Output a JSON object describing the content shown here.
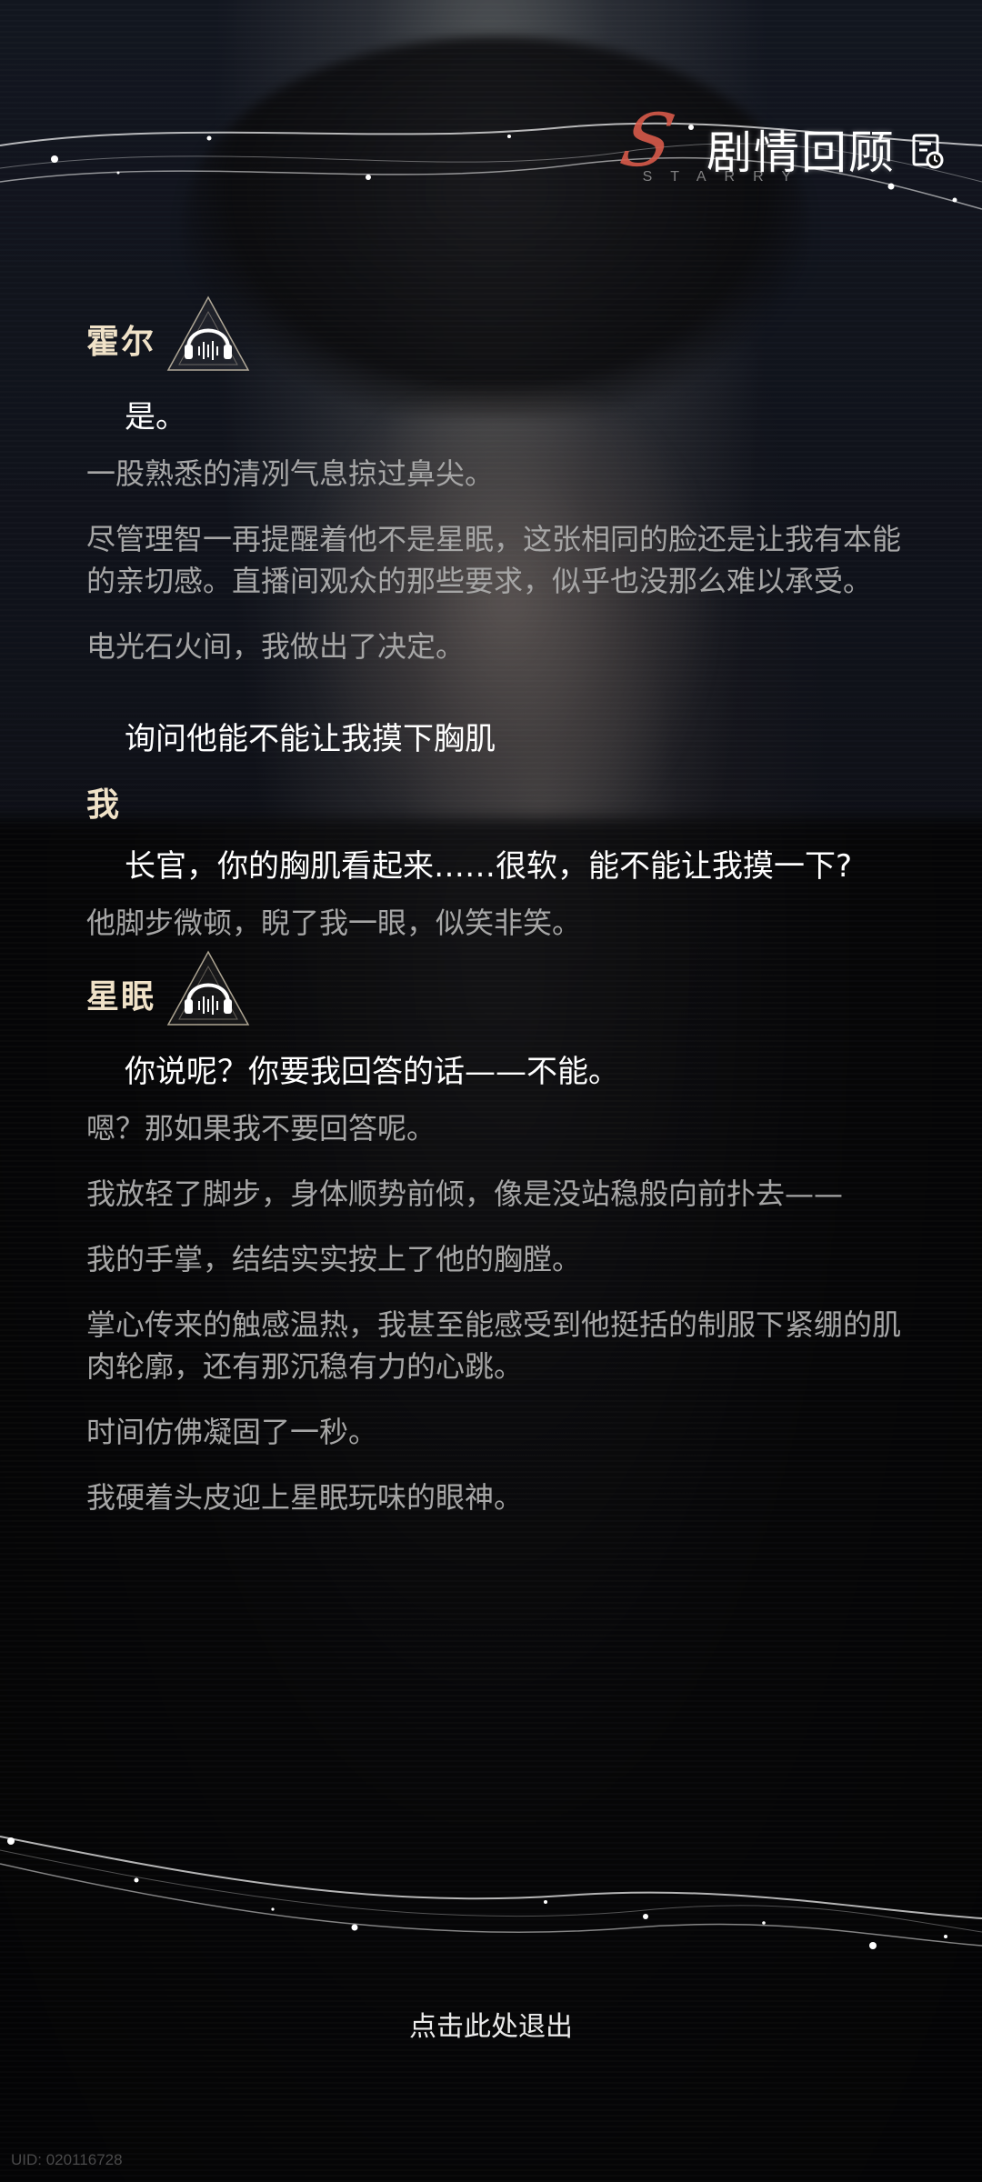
{
  "header": {
    "title": "剧情回顾",
    "subtitle": "STARRY",
    "icon": "story-review-icon"
  },
  "story": {
    "entries": [
      {
        "type": "speaker",
        "name": "霍尔",
        "icon": "headphone-voice-icon"
      },
      {
        "type": "line",
        "text": "是。"
      },
      {
        "type": "narration",
        "text": "一股熟悉的清冽气息掠过鼻尖。"
      },
      {
        "type": "narration",
        "text": "尽管理智一再提醒着他不是星眠，这张相同的脸还是让我有本能的亲切感。直播间观众的那些要求，似乎也没那么难以承受。"
      },
      {
        "type": "narration",
        "text": "电光石火间，我做出了决定。"
      },
      {
        "type": "choice",
        "text": "询问他能不能让我摸下胸肌"
      },
      {
        "type": "speaker",
        "name": "我"
      },
      {
        "type": "line",
        "text": "长官，你的胸肌看起来……很软，能不能让我摸一下?"
      },
      {
        "type": "narration",
        "text": "他脚步微顿，睨了我一眼，似笑非笑。"
      },
      {
        "type": "speaker",
        "name": "星眠",
        "icon": "headphone-voice-icon"
      },
      {
        "type": "line",
        "text": "你说呢？你要我回答的话——不能。"
      },
      {
        "type": "narration",
        "text": "嗯？那如果我不要回答呢。"
      },
      {
        "type": "narration",
        "text": "我放轻了脚步，身体顺势前倾，像是没站稳般向前扑去——"
      },
      {
        "type": "narration",
        "text": "我的手掌，结结实实按上了他的胸膛。"
      },
      {
        "type": "narration",
        "text": "掌心传来的触感温热，我甚至能感受到他挺括的制服下紧绷的肌肉轮廓，还有那沉稳有力的心跳。"
      },
      {
        "type": "narration",
        "text": "时间仿佛凝固了一秒。"
      },
      {
        "type": "narration",
        "text": "我硬着头皮迎上星眠玩味的眼神。"
      }
    ]
  },
  "footer": {
    "exit_label": "点击此处退出",
    "uid": "UID: 020116728"
  },
  "colors": {
    "speaker_name": "#f0e2c8",
    "narration": "#a6a6a6",
    "dialogue": "#ffffff",
    "accent": "#d85a4a"
  }
}
